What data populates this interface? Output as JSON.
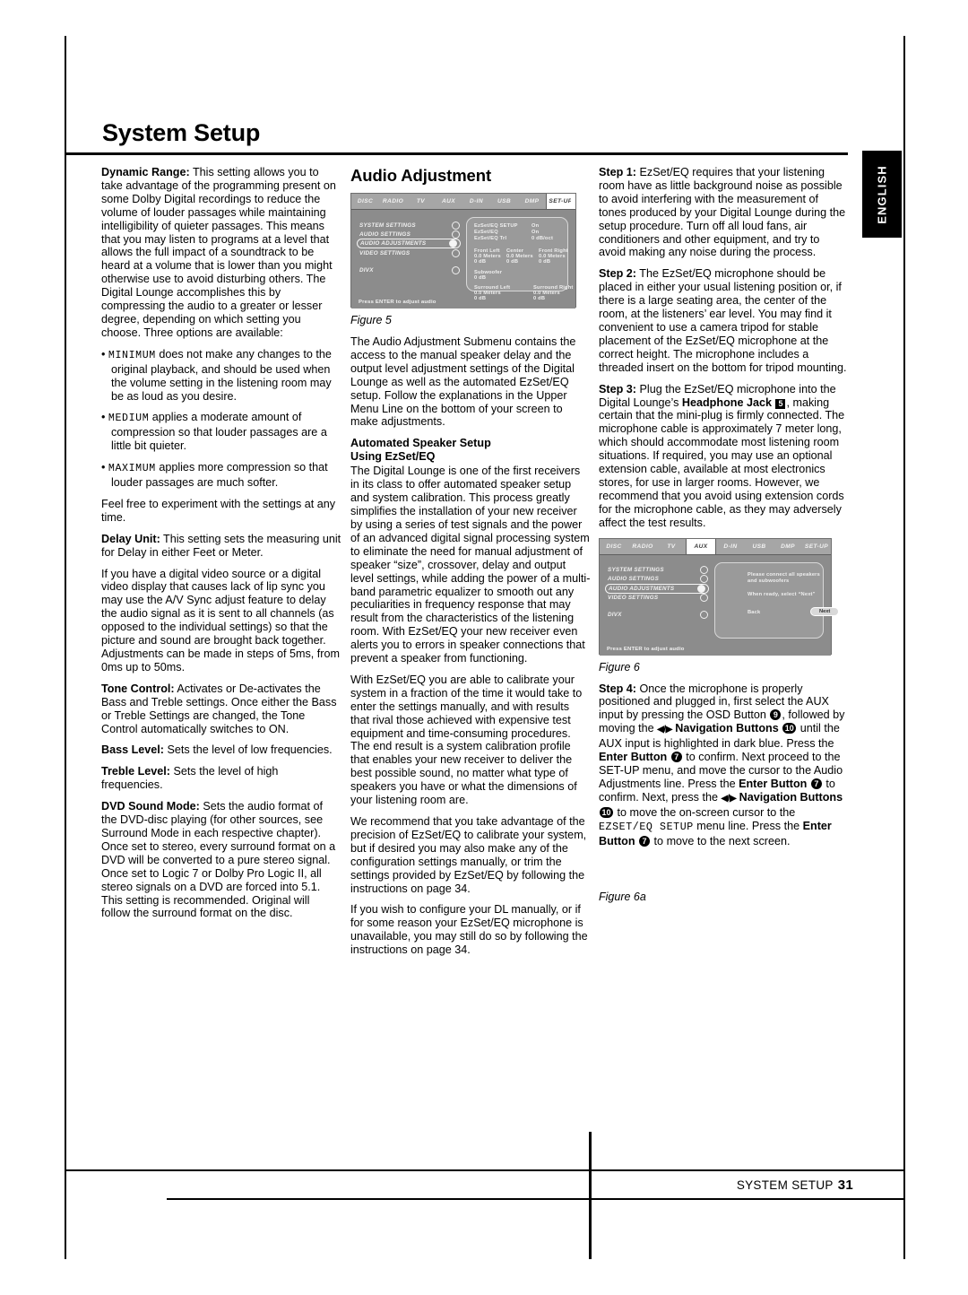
{
  "page": {
    "title": "System Setup",
    "language_tab": "ENGLISH",
    "footer_label": "SYSTEM SETUP",
    "footer_page_number": "31"
  },
  "column1": {
    "dynamic_range": {
      "term": "Dynamic Range:",
      "text": " This setting allows you to take advantage of the programming present on some Dolby Digital recordings to reduce the volume of louder passages while maintaining intelligibility of quieter passages. This means that you may listen to programs at a level that allows the full impact of a soundtrack to be heard at a volume that is lower than you might otherwise use to avoid disturbing others. The Digital Lounge accomplishes this by compressing the audio to a greater or lesser degree, depending on which setting you choose. Three options are available:"
    },
    "options": [
      {
        "name": "MINIMUM",
        "text": " does not make any changes to the original playback, and should be used when the volume setting in the listening room may be as loud as you desire."
      },
      {
        "name": "MEDIUM",
        "text": " applies a moderate amount of compression so that louder passages are a little bit quieter."
      },
      {
        "name": "MAXIMUM",
        "text": " applies more compression so that louder passages are much softer."
      }
    ],
    "experiment_note": "Feel free to experiment with the settings at any time.",
    "delay_unit": {
      "term": "Delay Unit:",
      "text": " This setting sets the measuring unit for Delay in either Feet or Meter."
    },
    "av_sync": "If you have a digital video source or a digital video display that causes lack of lip sync you may use the A/V Sync adjust feature to delay the audio signal as it is sent to all channels (as opposed to the individual settings) so that the picture and sound are brought back together. Adjustments can be made in steps of 5ms, from 0ms up to 50ms.",
    "tone_control": {
      "term": "Tone Control:",
      "text": " Activates or De-activates the Bass and Treble settings. Once either the Bass or Treble Settings are changed, the Tone Control automatically switches to ON."
    },
    "bass_level": {
      "term": "Bass Level:",
      "text": " Sets the level of low frequencies."
    },
    "treble_level": {
      "term": "Treble Level:",
      "text": " Sets the level of high frequencies."
    },
    "dvd_sound_mode": {
      "term": "DVD Sound Mode:",
      "text": " Sets the audio format of the DVD-disc playing (for other sources, see Surround Mode in each respective chapter). Once set to stereo, every surround format on a DVD will be converted to a pure stereo signal. Once set to Logic 7 or Dolby Pro Logic II, all stereo signals on a DVD are forced into 5.1. This setting is recommended. Original will follow the surround format on the disc."
    }
  },
  "column2": {
    "heading": "Audio Adjustment",
    "figure5_caption": "Figure 5",
    "intro": "The Audio Adjustment Submenu contains the access to the manual speaker delay and the output level adjustment settings of the Digital Lounge as well as the automated EzSet/EQ setup. Follow the explanations in the Upper Menu Line on the bottom of your screen to make adjustments.",
    "subheading_line1": "Automated Speaker Setup",
    "subheading_line2": "Using EzSet/EQ",
    "para1": "The Digital Lounge is one of the first receivers in its class to offer automated speaker setup and system calibration. This process greatly simplifies the installation of your new receiver by using a series of test signals and the power of an advanced digital signal processing system to eliminate the need for manual adjustment of speaker “size”, crossover, delay and output level settings, while adding the power of a multi-band parametric equalizer to smooth out any peculiarities in frequency response that may result from the characteristics of the listening room. With EzSet/EQ your new receiver even alerts you to errors in speaker connections that prevent a speaker from functioning.",
    "para2": "With EzSet/EQ you are able to calibrate your system in a fraction of the time it would take to enter the settings manually, and with results that rival those achieved with expensive test equipment and time-consuming procedures. The end result is a system calibration profile that enables your new receiver to deliver the best possible sound, no matter what type of speakers you have or what the dimensions of your listening room are.",
    "para3": "We recommend that you take advantage of the precision of EzSet/EQ to calibrate your system, but if desired you may also make any of the configuration settings manually, or trim the settings provided by EzSet/EQ by following the instructions on page 34.",
    "para4": "If you wish to configure your DL manually, or if for some reason your EzSet/EQ microphone is unavailable, you may still do so by following the instructions on page 34."
  },
  "column3": {
    "step1": {
      "label": "Step 1:",
      "text": " EzSet/EQ requires that your listening room have as little background noise as possible to avoid interfering with the measurement of tones produced by your Digital Lounge during the setup procedure. Turn off all loud fans, air conditioners and other equipment, and try to avoid making any noise during the process."
    },
    "step2": {
      "label": "Step 2:",
      "text": " The EzSet/EQ microphone should be placed in either your usual listening position or, if there is a large seating area, the center of the room, at the listeners’ ear level. You may find it convenient to use a camera tripod for stable placement of the EzSet/EQ microphone at the correct height. The microphone includes a threaded insert on the bottom for tripod mounting."
    },
    "step3": {
      "label": "Step 3:",
      "text_a": " Plug the EzSet/EQ microphone into the Digital Lounge’s ",
      "bold_b": "Headphone Jack",
      "badge_c": "5",
      "text_d": ", making certain that the mini-plug is firmly connected. The microphone cable is approximately 7 meter long, which should accommodate most listening room situations. If required, you may use an optional extension cable, available at most electronics stores, for use in larger rooms. However, we recommend that you avoid using extension cords for the microphone cable, as they may adversely affect the test results."
    },
    "figure6_caption": "Figure 6",
    "figure6a_caption": "Figure 6a",
    "step4": {
      "label": "Step 4:",
      "t1": " Once the microphone is properly positioned and plugged in, first select the AUX input by pressing the OSD Button ",
      "b1": "9",
      "t2": ", followed by moving the ",
      "nav1": "◀/▶",
      "b2_label": "Navigation Buttons",
      "b2": "10",
      "t3": " until the AUX input is highlighted in dark blue. Press the ",
      "b3_label": "Enter Button",
      "b3": "7",
      "t4": " to confirm. Next proceed to the SET-UP menu, and move the cursor to the Audio Adjustments line. Press the ",
      "b4_label": "Enter Button",
      "b4": "7",
      "t5": " to confirm. Next, press the ",
      "nav2": "◀/▶",
      "b5_label": "Navigation Buttons",
      "b5": "10",
      "t6": " to move the on-screen cursor to the ",
      "mono": "EZSET/EQ SETUP",
      "t7": " menu line. Press the ",
      "b6_label": "Enter Button",
      "b6": "7",
      "t8": " to move to the next screen."
    }
  },
  "osd_figure5": {
    "tabs": [
      "DISC",
      "RADIO",
      "TV",
      "AUX",
      "D-IN",
      "USB",
      "DMP",
      "SET-UP"
    ],
    "selected_tab": "SET-UP",
    "menu_items": [
      "SYSTEM SETTINGS",
      "AUDIO SETTINGS",
      "AUDIO ADJUSTMENTS",
      "VIDEO SETTINGS",
      "DIVX"
    ],
    "active_menu_item": "AUDIO ADJUSTMENTS",
    "panel": {
      "row1_label": "EzSet/EQ SETUP",
      "row1_value": "On",
      "row2_label": "EzSet/EQ",
      "row2_value": "On",
      "row3_label": "EzSet/EQ Trl",
      "row3_value": "0 dB/oct",
      "front_left_label": "Front Left",
      "front_left_dist": "0.0 Meters",
      "front_left_db": "0 dB",
      "center_label": "Center",
      "center_dist": "0.0 Meters",
      "center_db": "0 dB",
      "front_right_label": "Front Right",
      "front_right_dist": "0.0 Meters",
      "front_right_db": "0 dB",
      "subwoofer_label": "Subwoofer",
      "subwoofer_db": "0 dB",
      "surround_left_label": "Surround Left",
      "surround_left_dist": "0.0 Meters",
      "surround_left_db": "0 dB",
      "surround_right_label": "Surround Right",
      "surround_right_dist": "0.0 Meters",
      "surround_right_db": "0 dB"
    },
    "hint": "Press ENTER to adjust audio"
  },
  "osd_figure6": {
    "tabs": [
      "DISC",
      "RADIO",
      "TV",
      "AUX",
      "D-IN",
      "USB",
      "DMP",
      "SET-UP"
    ],
    "selected_tab": "AUX",
    "menu_items": [
      "SYSTEM SETTINGS",
      "AUDIO SETTINGS",
      "AUDIO ADJUSTMENTS",
      "VIDEO SETTINGS",
      "DIVX"
    ],
    "active_menu_item": "AUDIO ADJUSTMENTS",
    "panel": {
      "line1": "Please connect all speakers",
      "line2": "and subwoofers",
      "line3": "When ready, select “Next”",
      "back_label": "Back",
      "next_label": "Next"
    },
    "hint": "Press ENTER to adjust audio"
  }
}
